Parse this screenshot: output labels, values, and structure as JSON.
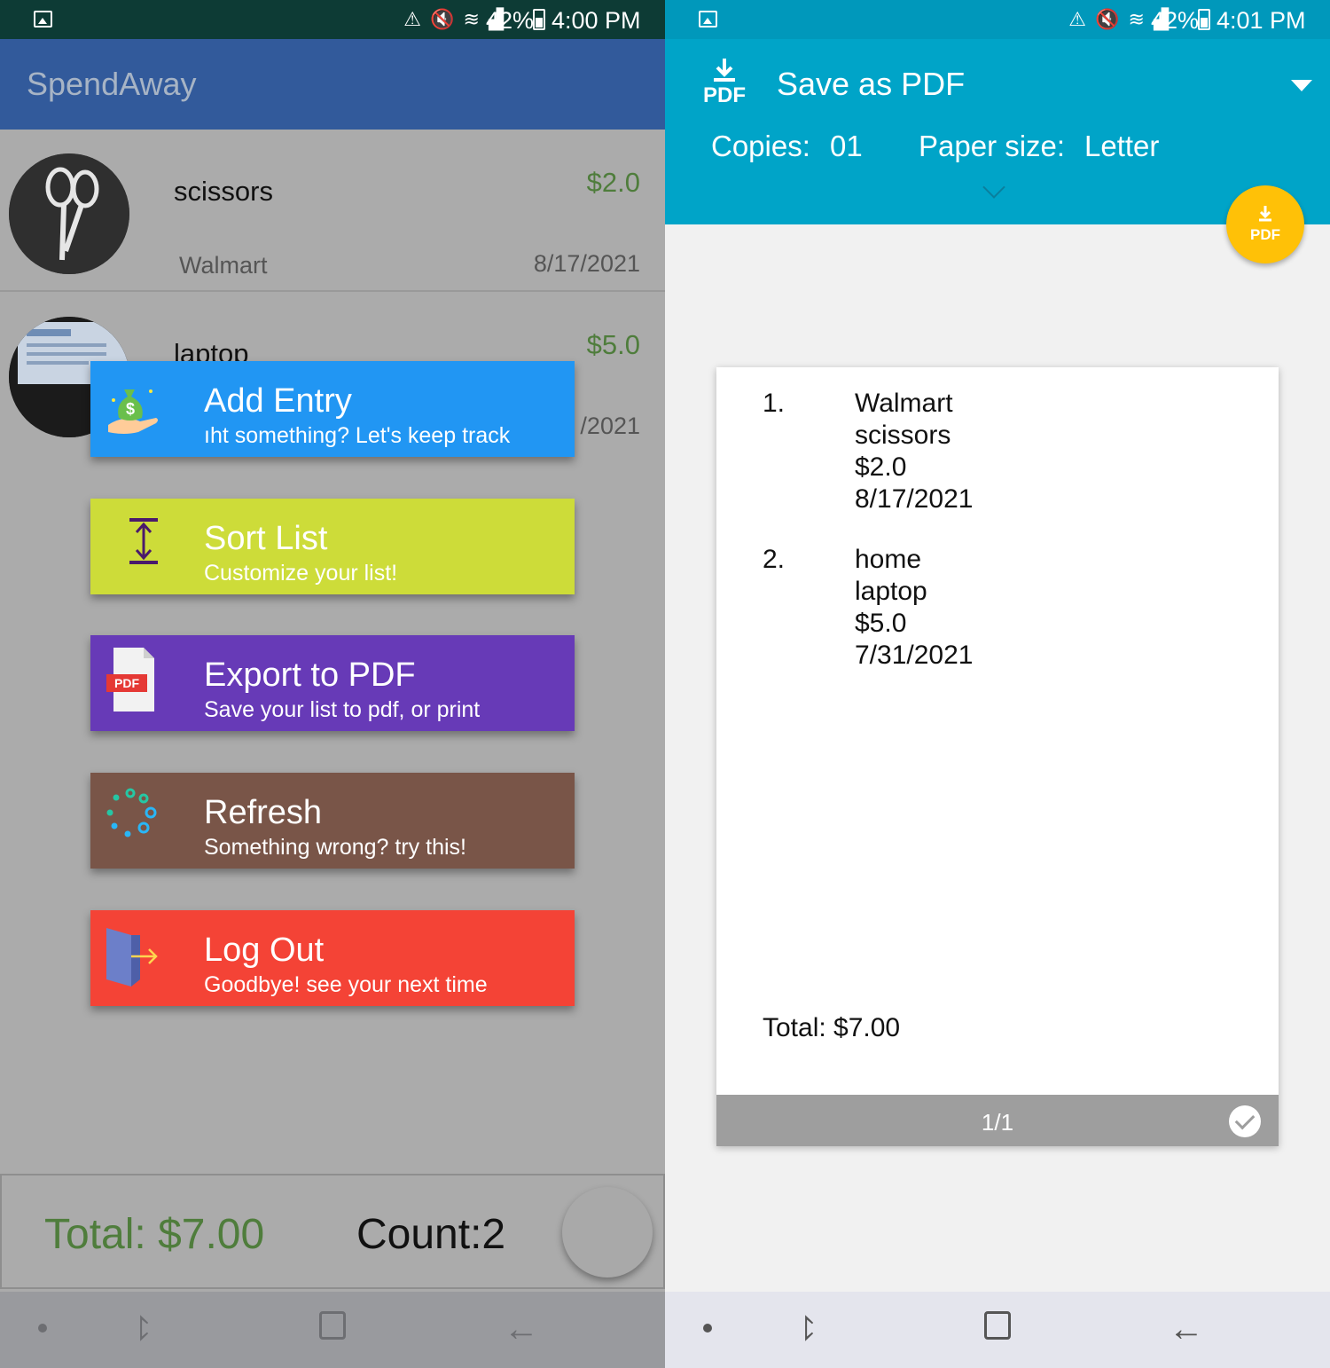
{
  "left_screen": {
    "status": {
      "battery": "42%",
      "time": "4:00 PM"
    },
    "app_title": "SpendAway",
    "items": [
      {
        "name": "scissors",
        "price": "$2.0",
        "store": "Walmart",
        "date": "8/17/2021"
      },
      {
        "name": "laptop",
        "price": "$5.0",
        "date_partial": "/2021"
      }
    ],
    "menu": [
      {
        "title": "Add Entry",
        "subtitle": "ıht something? Let's keep track",
        "color": "#2196f3",
        "icon": "money-bag-hand-icon"
      },
      {
        "title": "Sort List",
        "subtitle": "Customize your list!",
        "color": "#cddc39",
        "icon": "sort-vertical-icon"
      },
      {
        "title": "Export to PDF",
        "subtitle": "Save your list to pdf, or print",
        "color": "#673ab7",
        "icon": "pdf-file-icon"
      },
      {
        "title": "Refresh",
        "subtitle": "Something wrong? try this!",
        "color": "#795548",
        "icon": "refresh-dots-icon"
      },
      {
        "title": "Log Out",
        "subtitle": "Goodbye! see your next time",
        "color": "#f44336",
        "icon": "door-exit-icon"
      }
    ],
    "bottom": {
      "total": "Total: $7.00",
      "count": "Count:2"
    },
    "colors": {
      "app_bar": "#325a9b",
      "overlay": "#ababab",
      "price_green": "#4f7d3c"
    }
  },
  "right_screen": {
    "status": {
      "battery": "42%",
      "time": "4:01 PM"
    },
    "printer": {
      "icon_label": "PDF",
      "title": "Save as PDF"
    },
    "copies_label": "Copies:",
    "copies_value": "01",
    "paper_label": "Paper size:",
    "paper_value": "Letter",
    "fab_label": "PDF",
    "preview": {
      "entries": [
        {
          "num": "1.",
          "lines": [
            "Walmart",
            "scissors",
            "$2.0",
            "8/17/2021"
          ]
        },
        {
          "num": "2.",
          "lines": [
            "home",
            "laptop",
            "$5.0",
            "7/31/2021"
          ]
        }
      ],
      "total": "Total: $7.00",
      "page_indicator": "1/1"
    },
    "colors": {
      "header": "#00a4c8",
      "fab": "#ffc107",
      "page_footer": "#9e9e9e"
    }
  }
}
